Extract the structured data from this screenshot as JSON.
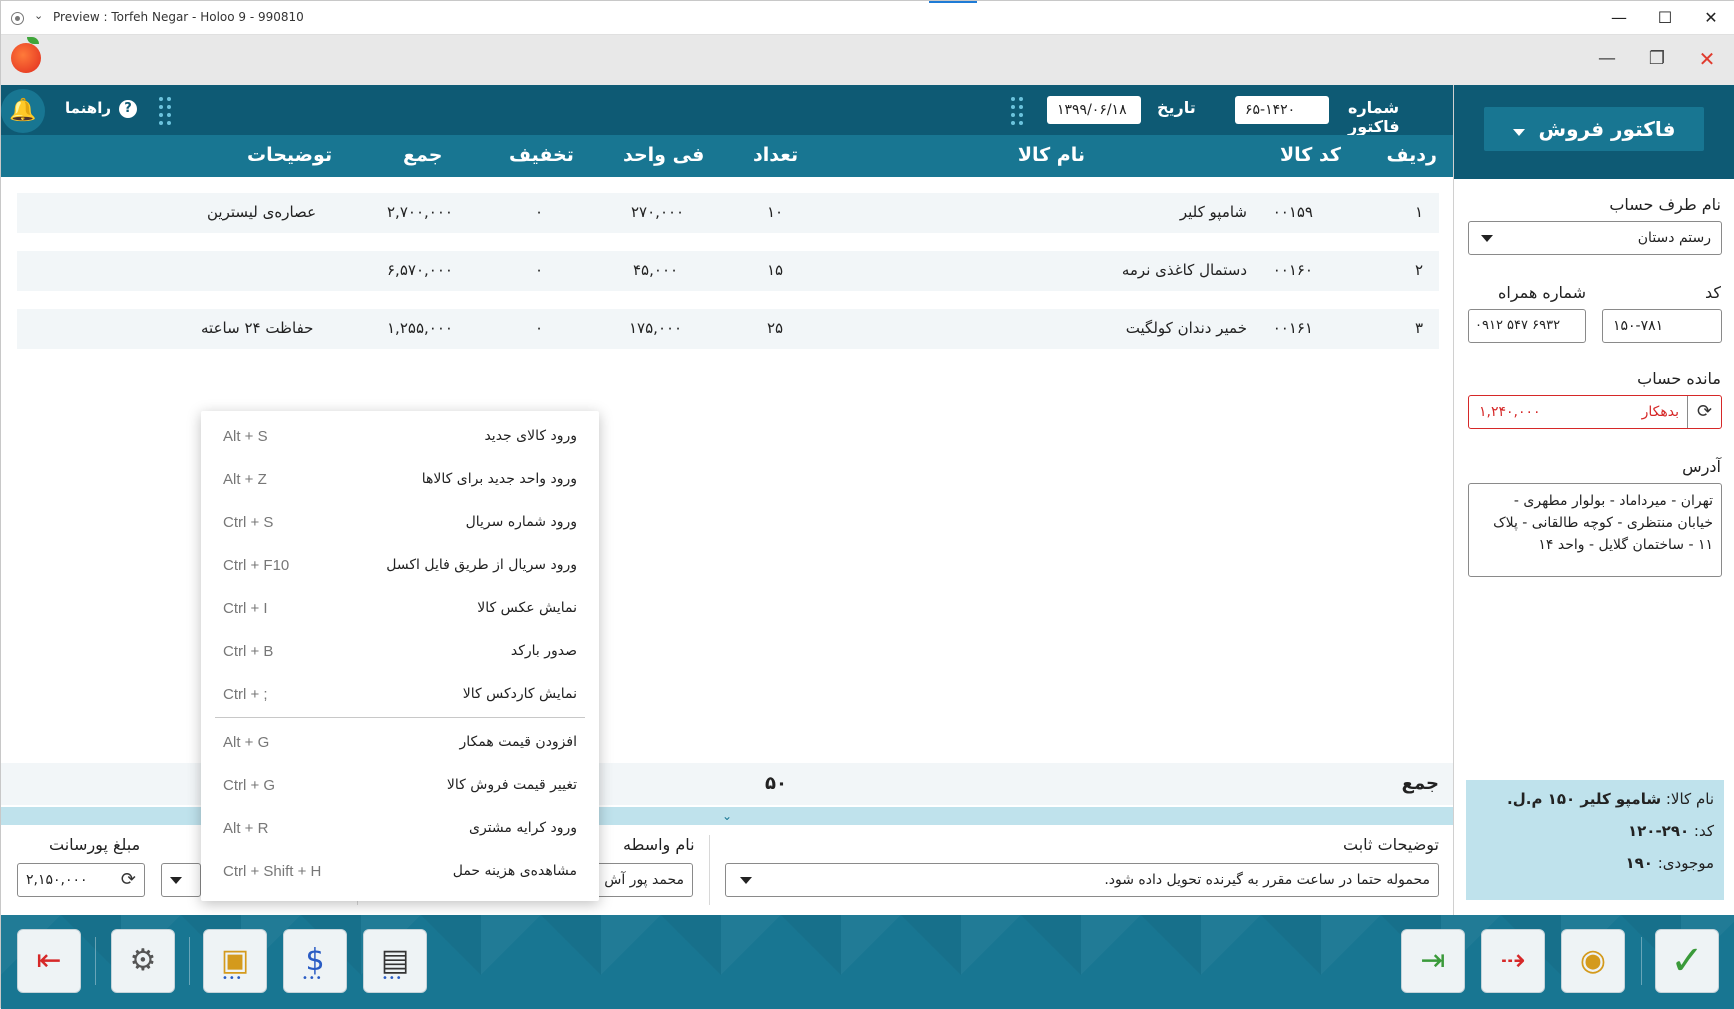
{
  "os": {
    "title": "Preview : Torfeh Negar - Holoo 9 - 990810"
  },
  "toolbar": {
    "help": "راهنما",
    "date_label": "تاریخ",
    "date_value": "۱۳۹۹/۰۶/۱۸",
    "invoice_label": "شماره فاکتور",
    "invoice_value": "۶۵-۱۴۲۰"
  },
  "table": {
    "headers": {
      "row": "ردیف",
      "code": "کد کالا",
      "name": "نام کالا",
      "qty": "تعداد",
      "unit_price": "فی واحد",
      "discount": "تخفیف",
      "total": "جمع",
      "desc": "توضیحات"
    },
    "rows": [
      {
        "row": "۱",
        "code": "۰۰۱۵۹",
        "name": "شامپو کلیر",
        "qty": "۱۰",
        "unit_price": "۲۷۰,۰۰۰",
        "discount": "۰",
        "total": "۲,۷۰۰,۰۰۰",
        "desc": "عصاره‌ی لیسترین"
      },
      {
        "row": "۲",
        "code": "۰۰۱۶۰",
        "name": "دستمال کاغذی نرمه",
        "qty": "۱۵",
        "unit_price": "۴۵,۰۰۰",
        "discount": "۰",
        "total": "۶,۵۷۰,۰۰۰",
        "desc": ""
      },
      {
        "row": "۳",
        "code": "۰۰۱۶۱",
        "name": "خمیر دندان کولگیت",
        "qty": "۲۵",
        "unit_price": "۱۷۵,۰۰۰",
        "discount": "۰",
        "total": "۱,۲۵۵,۰۰۰",
        "desc": "حفاظت ۲۴ ساعته"
      }
    ],
    "sum_label": "جمع",
    "sum_qty": "۵۰"
  },
  "footer": {
    "commission_label": "مبلغ پورسانت",
    "commission_value": "۲,۱۵۰,۰۰۰",
    "broker_label": "نام واسطه",
    "broker_value": "محمد پور آش",
    "notes_label": "توضیحات ثابت",
    "notes_value": "محموله حتما در ساعت مقرر به گیرنده تحویل داده شود."
  },
  "panel": {
    "tab": "فاکتور فروش",
    "account_label": "نام طرف حساب",
    "account_value": "رستم دستان",
    "code_label": "کد",
    "code_value": "۱۵۰-۷۸۱",
    "mobile_label": "شماره همراه",
    "mobile_value": "۰۹۱۲ ۵۴۷ ۶۹۳۲",
    "balance_label": "مانده حساب",
    "balance_status": "بدهکار",
    "balance_value": "۱,۲۴۰,۰۰۰",
    "address_label": "آدرس",
    "address_value": "تهران - میرداماد - بولوار مطهری - خیابان منتظری - کوچه طالقانی - پلاک ۱۱ - ساختمان گلایل - واحد ۱۴",
    "info": {
      "name_label": "نام کالا:",
      "name_value": "شامپو کلیر ۱۵۰ م.ل.",
      "code_label": "کد:",
      "code_value": "۲۹۰-۱۲۰",
      "stock_label": "موجودی:",
      "stock_value": "۱۹۰"
    }
  },
  "menu": {
    "items": [
      {
        "label": "ورود کالای جدید",
        "key": "Alt + S"
      },
      {
        "label": "ورود واحد جدید برای کالاها",
        "key": "Alt + Z"
      },
      {
        "label": "ورود شماره سریال",
        "key": "Ctrl + S"
      },
      {
        "label": "ورود سریال از طریق فایل اکسل",
        "key": "Ctrl + F10"
      },
      {
        "label": "نمایش عکس کالا",
        "key": "Ctrl + I"
      },
      {
        "label": "صدور بارکد",
        "key": "Ctrl + B"
      },
      {
        "label": "نمایش کاردکس کالا",
        "key": "Ctrl + ;"
      },
      {
        "label": "افزودن قیمت همکار",
        "key": "Alt + G"
      },
      {
        "label": "تغییر قیمت فروش کالا",
        "key": "Ctrl + G"
      },
      {
        "label": "ورود کرایه مشتری",
        "key": "Alt + R"
      },
      {
        "label": "مشاهده‌ی هزینه حمل",
        "key": "Ctrl + Shift + H"
      }
    ]
  },
  "colors": {
    "header_dark": "#0e5a74",
    "header": "#187692",
    "debt": "#d62828",
    "info_bg": "#bfe2ec"
  },
  "icons": [
    "record-icon",
    "chevron-down-icon",
    "minimize-icon",
    "maximize-icon",
    "close-icon",
    "app-logo-icon",
    "restore-icon",
    "bell-icon",
    "help-icon",
    "refresh-icon",
    "exit-icon",
    "settings-icon",
    "box-icon",
    "money-doc-icon",
    "calculator-icon",
    "import-doc-icon",
    "export-doc-icon",
    "preview-doc-icon",
    "checkmark-icon"
  ]
}
